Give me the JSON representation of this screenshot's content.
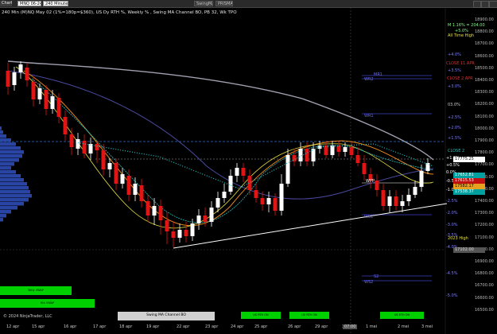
{
  "toolbar": {
    "chart_label": "Chart",
    "instrument": "MNQ 06-24",
    "timeframe": "240 Minute",
    "ma_label": "SwingMA",
    "prism_label": "PRISMA"
  },
  "chart_title": "240 Min (M)NQ May 02 (1%=180p=$360), US Dy RTH %, Weekly % , Swing MA Channel BO, PB 32, Wk TPO",
  "y_axis": {
    "ticks": [
      "18900.00",
      "18800.00",
      "18700.00",
      "18600.00",
      "18500.00",
      "18400.00",
      "18300.00",
      "18200.00",
      "18100.00",
      "18000.00",
      "17900.00",
      "17800.00",
      "17700.00",
      "17600.00",
      "17500.00",
      "17400.00",
      "17300.00",
      "17200.00",
      "17100.00",
      "17000.00",
      "16900.00",
      "16800.00",
      "16700.00",
      "16600.00",
      "16500.00"
    ]
  },
  "price_tags": {
    "current": "17775.25",
    "green_a": "17652.81",
    "red_a": "17615.53",
    "yellow_a": "17582.17",
    "green_b": "17538.37",
    "gray": "17102.00"
  },
  "annotations": {
    "ath_pct": "M 1.16% = 204.00",
    "ath_pct2": "+5.0%",
    "ath_label": "All Time High",
    "p4": "+4.0%",
    "close_apr": "CLOSE 11 APR",
    "p35": "+3.5%",
    "mr1": "MR1",
    "wr2": "WR2",
    "close_2": "CLOSE 2 APR",
    "p3": "+3.0%",
    "p03": "03.0%",
    "wr1": "WR1",
    "p25": "+2.5%",
    "p2": "+2.0%",
    "p15": "+1.5%",
    "close_may": "CLOSE 2",
    "p1": "+1.0%",
    "p05": "+0.5%",
    "p0": "0.0%",
    "wpp": "WPP",
    "m1": "-0.5%",
    "m2": "-1.0%",
    "m25": "-2.5%",
    "ws1": "WS1",
    "m3": "-2.0%",
    "m4": "-3.0%",
    "low_label": "2023 High",
    "m45": "-3.5%",
    "ws2": "WS2",
    "m5": "-4.0%",
    "m55": "-4.5%",
    "m6": "-5.0%",
    "s2": "S2",
    "ws2b": "WS2"
  },
  "x_axis": {
    "labels": [
      "12 apr",
      "15 apr",
      "16 apr",
      "17 apr",
      "18 apr",
      "19 apr",
      "22 apr",
      "23 apr",
      "24 apr",
      "25 apr",
      "26 apr",
      "29 apr",
      "30 apr",
      "1 mei",
      "2 mei",
      "3 mei"
    ],
    "cursor_time": "07:00"
  },
  "buttons": {
    "wkly_vwap": "Wkly VWAP",
    "vwap_rth": "Rth VWAP",
    "channel": "Swing MA Channel BO",
    "us_rth_a": "US RTH ON",
    "us_rth_b": "US RTH ON",
    "us_eth": "US ETH ON"
  },
  "copyright": "© 2024 NinjaTrader, LLC",
  "colors": {
    "bull": "#ffffff",
    "bear": "#e31414",
    "ma_gray": "#a0a0b0",
    "ma_blue": "#4a4aa0",
    "ma_orange": "#e88a1a",
    "ma_yellow": "#e8e040",
    "ma_cyan": "#20c0c0",
    "volume_profile": "#3355cc"
  }
}
